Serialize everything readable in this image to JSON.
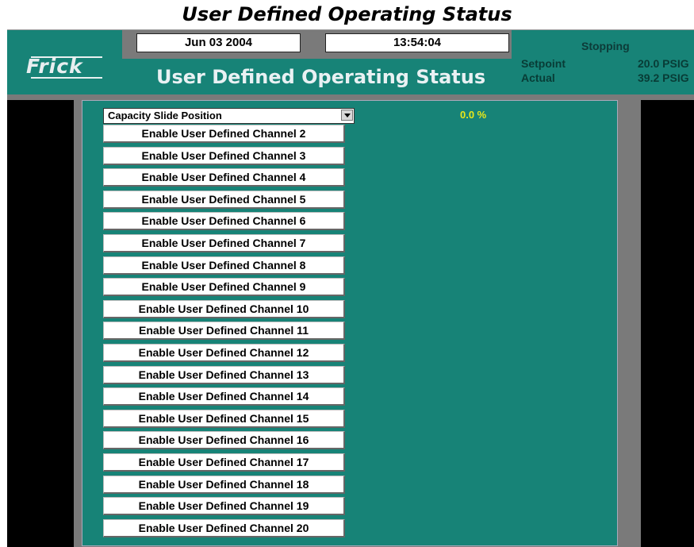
{
  "document_caption": "User Defined Operating Status",
  "header": {
    "date": "Jun 03 2004",
    "time": "13:54:04",
    "logo_text": "Frick",
    "screen_title": "User Defined Operating Status",
    "status": "Stopping",
    "setpoint_label": "Setpoint",
    "setpoint_value": "20.0 PSIG",
    "actual_label": "Actual",
    "actual_value": "39.2 PSIG"
  },
  "main": {
    "selector_value": "Capacity Slide Position",
    "readout": "0.0 %",
    "channels": [
      {
        "label": "Enable User Defined Channel 2"
      },
      {
        "label": "Enable User Defined Channel 3"
      },
      {
        "label": "Enable User Defined Channel 4"
      },
      {
        "label": "Enable User Defined Channel 5"
      },
      {
        "label": "Enable User Defined Channel 6"
      },
      {
        "label": "Enable User Defined Channel 7"
      },
      {
        "label": "Enable User Defined Channel 8"
      },
      {
        "label": "Enable User Defined Channel 9"
      },
      {
        "label": "Enable User Defined Channel 10"
      },
      {
        "label": "Enable User Defined Channel 11"
      },
      {
        "label": "Enable User Defined Channel 12"
      },
      {
        "label": "Enable User Defined Channel 13"
      },
      {
        "label": "Enable User Defined Channel 14"
      },
      {
        "label": "Enable User Defined Channel 15"
      },
      {
        "label": "Enable User Defined Channel 16"
      },
      {
        "label": "Enable User Defined Channel 17"
      },
      {
        "label": "Enable User Defined Channel 18"
      },
      {
        "label": "Enable User Defined Channel 19"
      },
      {
        "label": "Enable User Defined Channel 20"
      }
    ]
  },
  "colors": {
    "panel_teal": "#178377",
    "frame_gray": "#7a7a7a",
    "readout_yellow": "#e8e81a"
  }
}
